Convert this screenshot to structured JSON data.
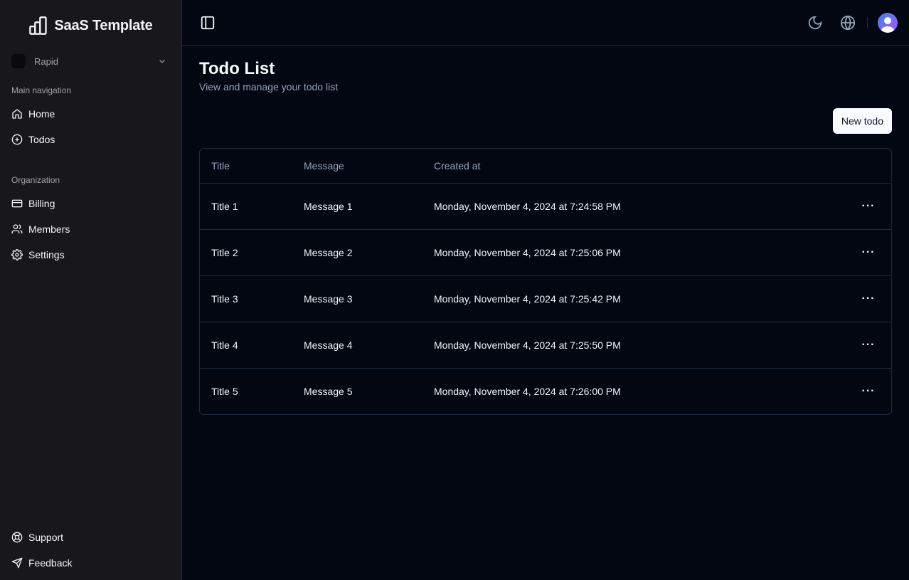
{
  "brand": {
    "name": "SaaS Template",
    "icon": "chart-bars-icon"
  },
  "org": {
    "name": "Rapid"
  },
  "sidebar": {
    "groups": [
      {
        "label": "Main navigation",
        "items": [
          {
            "label": "Home",
            "icon": "home-icon"
          },
          {
            "label": "Todos",
            "icon": "plus-circle-icon"
          }
        ]
      },
      {
        "label": "Organization",
        "items": [
          {
            "label": "Billing",
            "icon": "credit-card-icon"
          },
          {
            "label": "Members",
            "icon": "users-icon"
          },
          {
            "label": "Settings",
            "icon": "gear-icon"
          }
        ]
      }
    ],
    "footer": [
      {
        "label": "Support",
        "icon": "life-buoy-icon"
      },
      {
        "label": "Feedback",
        "icon": "send-icon"
      }
    ]
  },
  "topbar": {
    "toggle_icon": "sidebar-toggle-icon",
    "theme_icon": "moon-icon",
    "language_icon": "globe-icon",
    "avatar_icon": "user-avatar"
  },
  "page": {
    "title": "Todo List",
    "subtitle": "View and manage your todo list",
    "new_button": "New todo"
  },
  "table": {
    "headers": [
      "Title",
      "Message",
      "Created at"
    ],
    "rows": [
      {
        "title": "Title 1",
        "message": "Message 1",
        "created_at": "Monday, November 4, 2024 at 7:24:58 PM"
      },
      {
        "title": "Title 2",
        "message": "Message 2",
        "created_at": "Monday, November 4, 2024 at 7:25:06 PM"
      },
      {
        "title": "Title 3",
        "message": "Message 3",
        "created_at": "Monday, November 4, 2024 at 7:25:42 PM"
      },
      {
        "title": "Title 4",
        "message": "Message 4",
        "created_at": "Monday, November 4, 2024 at 7:25:50 PM"
      },
      {
        "title": "Title 5",
        "message": "Message 5",
        "created_at": "Monday, November 4, 2024 at 7:26:00 PM"
      }
    ],
    "row_action": "···"
  }
}
